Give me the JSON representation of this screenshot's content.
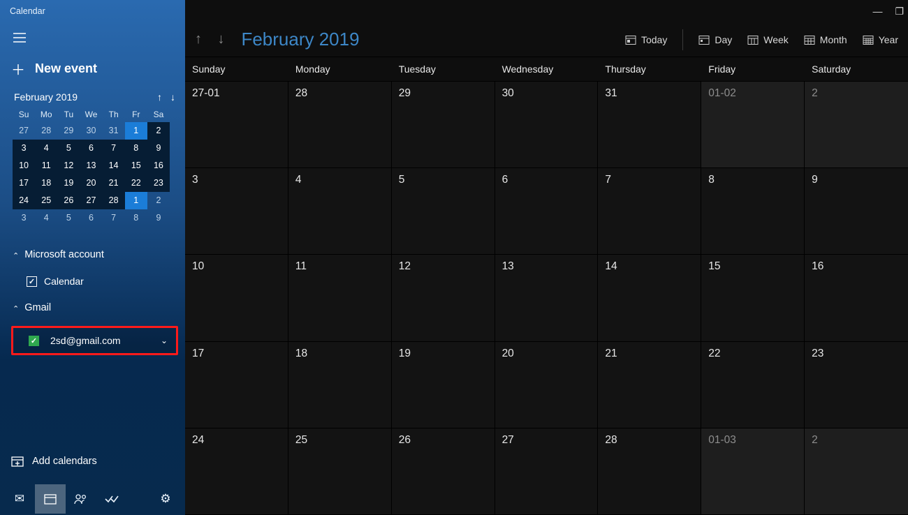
{
  "app_title": "Calendar",
  "new_event_label": "New event",
  "mini": {
    "title": "February 2019",
    "dow": [
      "Su",
      "Mo",
      "Tu",
      "We",
      "Th",
      "Fr",
      "Sa"
    ],
    "weeks": [
      [
        {
          "d": "27",
          "o": true
        },
        {
          "d": "28",
          "o": true
        },
        {
          "d": "29",
          "o": true
        },
        {
          "d": "30",
          "o": true
        },
        {
          "d": "31",
          "o": true
        },
        {
          "d": "1",
          "today": true
        },
        {
          "d": "2",
          "cur": true
        }
      ],
      [
        {
          "d": "3",
          "cur": true
        },
        {
          "d": "4",
          "cur": true
        },
        {
          "d": "5",
          "cur": true
        },
        {
          "d": "6",
          "cur": true
        },
        {
          "d": "7",
          "cur": true
        },
        {
          "d": "8",
          "cur": true
        },
        {
          "d": "9",
          "cur": true
        }
      ],
      [
        {
          "d": "10",
          "cur": true
        },
        {
          "d": "11",
          "cur": true
        },
        {
          "d": "12",
          "cur": true
        },
        {
          "d": "13",
          "cur": true
        },
        {
          "d": "14",
          "cur": true
        },
        {
          "d": "15",
          "cur": true
        },
        {
          "d": "16",
          "cur": true
        }
      ],
      [
        {
          "d": "17",
          "cur": true
        },
        {
          "d": "18",
          "cur": true
        },
        {
          "d": "19",
          "cur": true
        },
        {
          "d": "20",
          "cur": true
        },
        {
          "d": "21",
          "cur": true
        },
        {
          "d": "22",
          "cur": true
        },
        {
          "d": "23",
          "cur": true
        }
      ],
      [
        {
          "d": "24",
          "cur": true
        },
        {
          "d": "25",
          "cur": true
        },
        {
          "d": "26",
          "cur": true
        },
        {
          "d": "27",
          "cur": true
        },
        {
          "d": "28",
          "cur": true
        },
        {
          "d": "1",
          "today": true
        },
        {
          "d": "2",
          "o": true
        }
      ],
      [
        {
          "d": "3",
          "o": true
        },
        {
          "d": "4",
          "o": true
        },
        {
          "d": "5",
          "o": true
        },
        {
          "d": "6",
          "o": true
        },
        {
          "d": "7",
          "o": true
        },
        {
          "d": "8",
          "o": true
        },
        {
          "d": "9",
          "o": true
        }
      ]
    ]
  },
  "accounts": {
    "ms": {
      "label": "Microsoft account",
      "calendar_label": "Calendar"
    },
    "gmail": {
      "label": "Gmail",
      "email": "2sd@gmail.com"
    }
  },
  "add_calendars_label": "Add calendars",
  "toolbar": {
    "title": "February 2019",
    "today": "Today",
    "day": "Day",
    "week": "Week",
    "month": "Month",
    "year": "Year"
  },
  "dow": [
    "Sunday",
    "Monday",
    "Tuesday",
    "Wednesday",
    "Thursday",
    "Friday",
    "Saturday"
  ],
  "grid": [
    [
      {
        "t": "27-01",
        "out": false
      },
      {
        "t": "28"
      },
      {
        "t": "29"
      },
      {
        "t": "30"
      },
      {
        "t": "31"
      },
      {
        "t": "01-02",
        "out": true
      },
      {
        "t": "2",
        "out": true
      }
    ],
    [
      {
        "t": "3"
      },
      {
        "t": "4"
      },
      {
        "t": "5"
      },
      {
        "t": "6"
      },
      {
        "t": "7"
      },
      {
        "t": "8"
      },
      {
        "t": "9"
      }
    ],
    [
      {
        "t": "10"
      },
      {
        "t": "11"
      },
      {
        "t": "12"
      },
      {
        "t": "13"
      },
      {
        "t": "14"
      },
      {
        "t": "15"
      },
      {
        "t": "16"
      }
    ],
    [
      {
        "t": "17"
      },
      {
        "t": "18"
      },
      {
        "t": "19"
      },
      {
        "t": "20"
      },
      {
        "t": "21"
      },
      {
        "t": "22"
      },
      {
        "t": "23"
      }
    ],
    [
      {
        "t": "24"
      },
      {
        "t": "25"
      },
      {
        "t": "26"
      },
      {
        "t": "27"
      },
      {
        "t": "28"
      },
      {
        "t": "01-03",
        "out": true
      },
      {
        "t": "2",
        "out": true
      }
    ]
  ]
}
